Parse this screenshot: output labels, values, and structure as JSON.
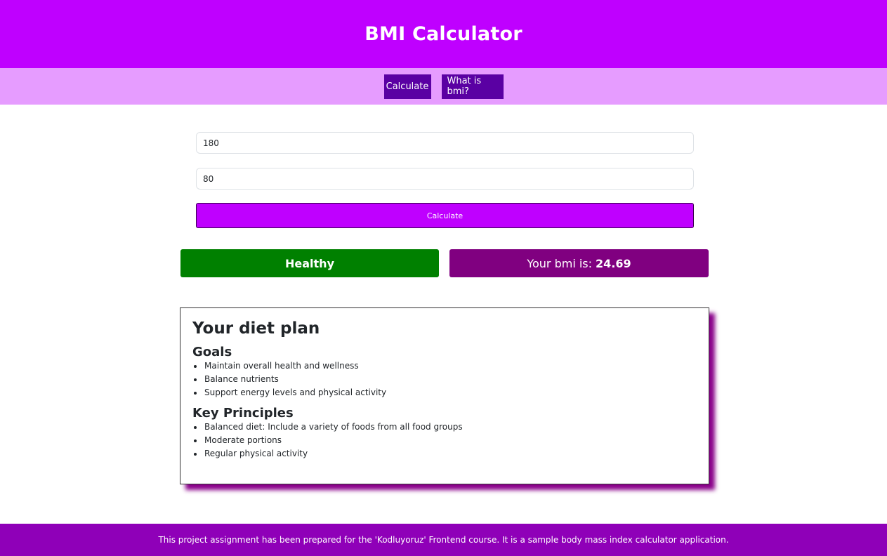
{
  "header": {
    "title": "BMI Calculator"
  },
  "nav": {
    "calculate_label": "Calculate",
    "what_is_bmi_label": "What is bmi?"
  },
  "form": {
    "height_value": "180",
    "weight_value": "80",
    "calculate_button_label": "Calculate"
  },
  "result": {
    "status": "Healthy",
    "bmi_prefix": "Your bmi is:",
    "bmi_value": "24.69"
  },
  "diet_plan": {
    "title": "Your diet plan",
    "goals_heading": "Goals",
    "goals": [
      "Maintain overall health and wellness",
      "Balance nutrients",
      "Support energy levels and physical activity"
    ],
    "principles_heading": "Key Principles",
    "principles": [
      "Balanced diet: Include a variety of foods from all food groups",
      "Moderate portions",
      "Regular physical activity"
    ]
  },
  "footer": {
    "text": "This project assignment has been prepared for the 'Kodluyoruz' Frontend course. It is a sample body mass index calculator application."
  },
  "colors": {
    "header_bg": "#bf00ff",
    "nav_bg": "#e69cff",
    "nav_button_bg": "#5a00a3",
    "status_healthy": "#008000",
    "bmi_box_bg": "#800080",
    "footer_bg": "#8f00b8"
  }
}
